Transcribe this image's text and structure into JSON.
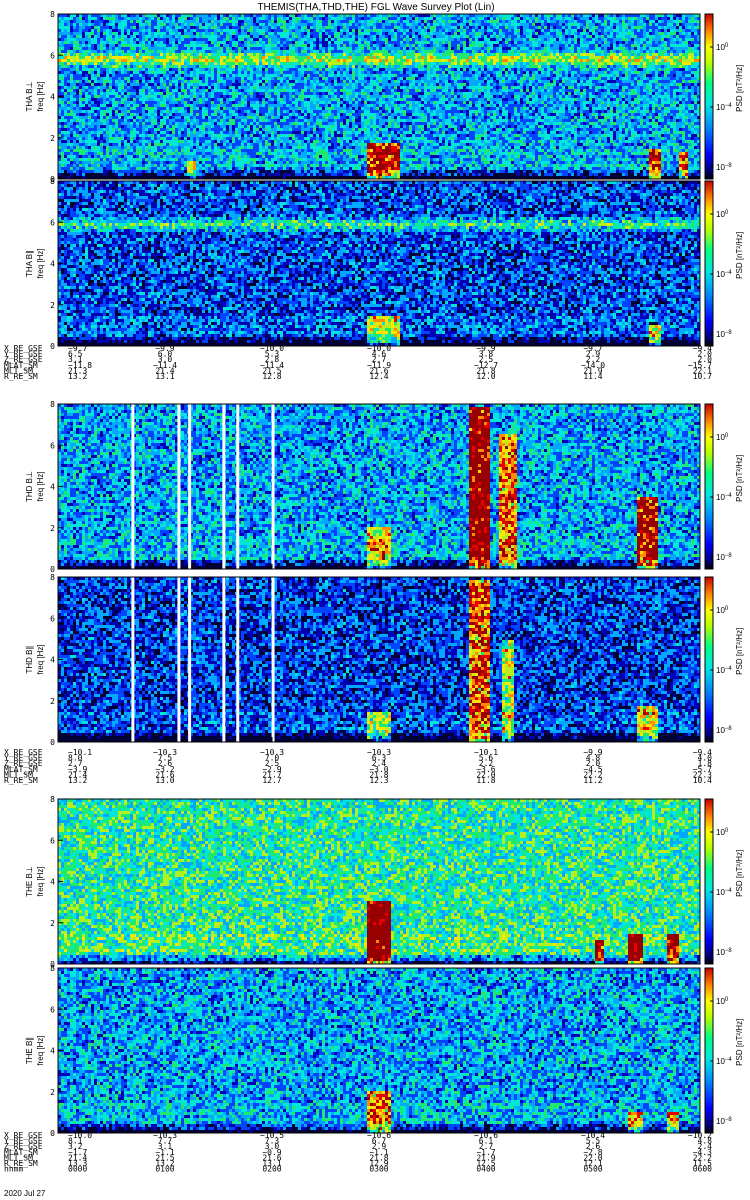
{
  "title": "THEMIS(THA,THD,THE) FGL Wave Survey Plot (Lin)",
  "colors": {
    "colormap": [
      "#000033",
      "#0000b4",
      "#0044ff",
      "#00a8ff",
      "#00e6d8",
      "#1ee86e",
      "#b4f01e",
      "#ffe600",
      "#ff8c00",
      "#e60000",
      "#960000"
    ],
    "background_noise": "#2a5fd8",
    "data_gap": "#ffffff"
  },
  "chart_data": {
    "type": "heatmap",
    "x_tick_times_hhmm": [
      "0000",
      "0100",
      "0200",
      "0300",
      "0400",
      "0500",
      "0600"
    ],
    "date": "2020 Jul 27",
    "ylim_freq_hz": [
      0,
      8
    ],
    "y_ticks": [
      "0",
      "2",
      "4",
      "6",
      "8"
    ],
    "colorbar": {
      "label": "PSD [nT²/Hz]",
      "scale": "log",
      "range_exponents": [
        -8.8,
        2.2
      ],
      "tick_exponents": [
        0,
        -4,
        -8
      ],
      "tick_labels": [
        {
          "base": "10",
          "exp": "0"
        },
        {
          "base": "10",
          "exp": "−4"
        },
        {
          "base": "10",
          "exp": "−8"
        }
      ]
    },
    "panels": [
      {
        "ylabel": "THA B⊥",
        "freq_label": "freq [Hz]",
        "band_at_hz": 5.8,
        "band_strength": 0.55,
        "brightness": 0.32,
        "seed": 11,
        "bursts": [
          {
            "t": 3.05,
            "w": 0.15,
            "s": 0.7,
            "fmax": 1.8
          },
          {
            "t": 5.58,
            "w": 0.06,
            "s": 0.7,
            "fmax": 1.5
          },
          {
            "t": 5.85,
            "w": 0.05,
            "s": 0.6,
            "fmax": 1.3
          },
          {
            "t": 1.25,
            "w": 0.05,
            "s": 0.4,
            "fmax": 0.8
          }
        ]
      },
      {
        "ylabel": "THA B∥",
        "freq_label": "freq [Hz]",
        "band_at_hz": 5.9,
        "band_strength": 0.45,
        "brightness": 0.22,
        "seed": 23,
        "bursts": [
          {
            "t": 3.05,
            "w": 0.15,
            "s": 0.5,
            "fmax": 1.5
          },
          {
            "t": 5.58,
            "w": 0.06,
            "s": 0.6,
            "fmax": 1.0
          }
        ]
      },
      {
        "ylabel": "THD B⊥",
        "freq_label": "freq [Hz]",
        "band_at_hz": 0,
        "band_strength": 0,
        "brightness": 0.32,
        "seed": 37,
        "bursts": [
          {
            "t": 3.0,
            "w": 0.1,
            "s": 0.5,
            "fmax": 2.0
          },
          {
            "t": 3.95,
            "w": 0.1,
            "s": 0.9,
            "fmax": 7.8
          },
          {
            "t": 4.2,
            "w": 0.08,
            "s": 0.6,
            "fmax": 6.5
          },
          {
            "t": 5.5,
            "w": 0.1,
            "s": 0.8,
            "fmax": 3.5
          }
        ]
      },
      {
        "ylabel": "THD B∥",
        "freq_label": "freq [Hz]",
        "band_at_hz": 0,
        "band_strength": 0,
        "brightness": 0.2,
        "seed": 41,
        "bursts": [
          {
            "t": 3.0,
            "w": 0.1,
            "s": 0.45,
            "fmax": 1.5
          },
          {
            "t": 3.95,
            "w": 0.1,
            "s": 0.8,
            "fmax": 7.8
          },
          {
            "t": 4.2,
            "w": 0.06,
            "s": 0.5,
            "fmax": 5.0
          },
          {
            "t": 5.5,
            "w": 0.1,
            "s": 0.6,
            "fmax": 1.8
          }
        ]
      },
      {
        "ylabel": "THE B⊥",
        "freq_label": "freq [Hz]",
        "band_at_hz": 0,
        "band_strength": 0,
        "brightness": 0.46,
        "seed": 53,
        "bursts": [
          {
            "t": 3.0,
            "w": 0.1,
            "s": 0.8,
            "fmax": 3.0
          },
          {
            "t": 5.05,
            "w": 0.04,
            "s": 0.6,
            "fmax": 1.2
          },
          {
            "t": 5.4,
            "w": 0.08,
            "s": 0.8,
            "fmax": 1.5
          },
          {
            "t": 5.75,
            "w": 0.06,
            "s": 0.7,
            "fmax": 1.5
          }
        ]
      },
      {
        "ylabel": "THE B∥",
        "freq_label": "freq [Hz]",
        "band_at_hz": 0,
        "band_strength": 0,
        "brightness": 0.32,
        "seed": 67,
        "bursts": [
          {
            "t": 3.0,
            "w": 0.1,
            "s": 0.6,
            "fmax": 2.0
          },
          {
            "t": 5.4,
            "w": 0.08,
            "s": 0.6,
            "fmax": 1.0
          },
          {
            "t": 5.75,
            "w": 0.06,
            "s": 0.5,
            "fmax": 1.0
          }
        ]
      }
    ],
    "data_gaps_hours": [
      0.7,
      1.13,
      1.23,
      1.55,
      1.68,
      2.01
    ],
    "data_gaps_apply_to_group": 1,
    "ephemeris_groups": [
      {
        "rows": [
          {
            "label": "X_RE_GSE",
            "values": [
              "−9.7",
              "−9.9",
              "−10.0",
              "−10.0",
              "−9.9",
              "−9.7",
              "−9.4"
            ]
          },
          {
            "label": "Y_RE_GSE",
            "values": [
              "6.5",
              "6.0",
              "5.3",
              "4.6",
              "3.8",
              "2.9",
              "2.0"
            ]
          },
          {
            "label": "Z_RE_GSE",
            "values": [
              "3.1",
              "3.0",
              "2.8",
              "2.7",
              "2.5",
              "2.2",
              "2.0"
            ]
          },
          {
            "label": "MLAT_SM",
            "values": [
              "−11.8",
              "−11.4",
              "−11.4",
              "−11.9",
              "−12.7",
              "−14.0",
              "−15.7"
            ]
          },
          {
            "label": "MLT_SM",
            "values": [
              "21.3",
              "21.4",
              "21.5",
              "21.6",
              "21.8",
              "21.9",
              "22.1"
            ]
          },
          {
            "label": "R_RE_SM",
            "values": [
              "13.2",
              "13.1",
              "12.8",
              "12.4",
              "12.0",
              "11.4",
              "10.7"
            ]
          }
        ]
      },
      {
        "rows": [
          {
            "label": "X_RE_GSE",
            "values": [
              "−10.1",
              "−10.3",
              "−10.3",
              "−10.3",
              "−10.1",
              "−9.9",
              "−9.4"
            ]
          },
          {
            "label": "Y_RE_GSE",
            "values": [
              "8.0",
              "7.5",
              "7.0",
              "6.3",
              "5.6",
              "4.8",
              "4.0"
            ]
          },
          {
            "label": "Z_RE_GSE",
            "values": [
              "2.7",
              "2.6",
              "2.5",
              "2.4",
              "2.2",
              "2.0",
              "1.8"
            ]
          },
          {
            "label": "MLAT_SM",
            "values": [
              "−3.9",
              "−3.2",
              "−2.9",
              "−3.0",
              "−3.6",
              "−4.5",
              "−5.7"
            ]
          },
          {
            "label": "MLT_SM",
            "values": [
              "21.4",
              "21.6",
              "21.7",
              "21.8",
              "22.0",
              "22.2",
              "22.3"
            ]
          },
          {
            "label": "R_RE_SM",
            "values": [
              "13.2",
              "13.0",
              "12.7",
              "12.3",
              "11.8",
              "11.2",
              "10.4"
            ]
          }
        ]
      },
      {
        "rows": [
          {
            "label": "X_RE_GSE",
            "values": [
              "−10.0",
              "−10.3",
              "−10.5",
              "−10.6",
              "−10.6",
              "−10.4",
              "−10.2"
            ]
          },
          {
            "label": "Y_RE_GSE",
            "values": [
              "8.1",
              "7.7",
              "7.3",
              "6.7",
              "6.1",
              "5.5",
              "4.8"
            ]
          },
          {
            "label": "Z_RE_GSE",
            "values": [
              "3.2",
              "3.1",
              "3.0",
              "2.9",
              "2.7",
              "2.6",
              "2.4"
            ]
          },
          {
            "label": "MLAT_SM",
            "values": [
              "−1.7",
              "−1.1",
              "−0.9",
              "−1.1",
              "−1.7",
              "−2.8",
              "−4.3"
            ]
          },
          {
            "label": "MLT_SM",
            "values": [
              "21.4",
              "21.5",
              "21.6",
              "21.8",
              "21.9",
              "22.0",
              "22.2"
            ]
          },
          {
            "label": "R_RE_SM",
            "values": [
              "13.3",
              "13.2",
              "13.1",
              "12.9",
              "12.5",
              "12.1",
              "11.5"
            ]
          },
          {
            "label": "hhmm",
            "values": [
              "0000",
              "0100",
              "0200",
              "0300",
              "0400",
              "0500",
              "0600"
            ]
          }
        ]
      }
    ]
  }
}
